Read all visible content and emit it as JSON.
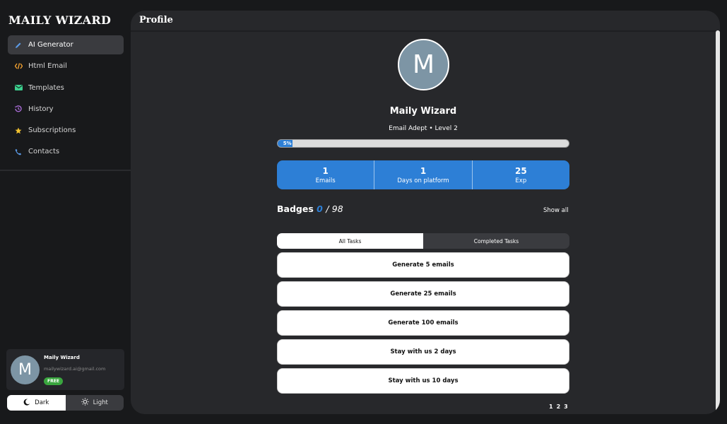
{
  "app": {
    "brand": "MAILY WIZARD"
  },
  "sidebar": {
    "items": [
      {
        "label": "AI Generator",
        "icon": "pencil-icon",
        "color": "#5b9be8",
        "active": true
      },
      {
        "label": "Html Email",
        "icon": "code-icon",
        "color": "#f0a030"
      },
      {
        "label": "Templates",
        "icon": "envelope-icon",
        "color": "#3ccf8e"
      },
      {
        "label": "History",
        "icon": "history-icon",
        "color": "#b070e0"
      },
      {
        "label": "Subscriptions",
        "icon": "star-icon",
        "color": "#f2c230"
      },
      {
        "label": "Contacts",
        "icon": "phone-icon",
        "color": "#5b9be8"
      }
    ]
  },
  "user": {
    "initial": "M",
    "name": "Maily Wizard",
    "email": "mailywizard.ai@gmail.com",
    "plan": "FREE"
  },
  "theme": {
    "dark_label": "Dark",
    "light_label": "Light",
    "selected": "Dark"
  },
  "header": {
    "title": "Profile"
  },
  "profile": {
    "initial": "M",
    "name": "Maily Wizard",
    "level": "Email Adept • Level 2",
    "progress_label": "5%",
    "progress_percent": 5
  },
  "stats": [
    {
      "value": "1",
      "label": "Emails"
    },
    {
      "value": "1",
      "label": "Days on platform"
    },
    {
      "value": "25",
      "label": "Exp"
    }
  ],
  "badges": {
    "title": "Badges",
    "count": "0",
    "separator": "/",
    "total": "98",
    "show_all": "Show all"
  },
  "tabs": [
    {
      "label": "All Tasks",
      "active": true
    },
    {
      "label": "Completed Tasks",
      "active": false
    }
  ],
  "tasks": [
    "Generate 5 emails",
    "Generate 25 emails",
    "Generate 100 emails",
    "Stay with us 2 days",
    "Stay with us 10 days"
  ],
  "pagination": [
    "1",
    "2",
    "3"
  ],
  "colors": {
    "accent": "#2d7fd6",
    "badge_green": "#3aa63f",
    "panel": "#27282b",
    "background": "#18191b"
  }
}
